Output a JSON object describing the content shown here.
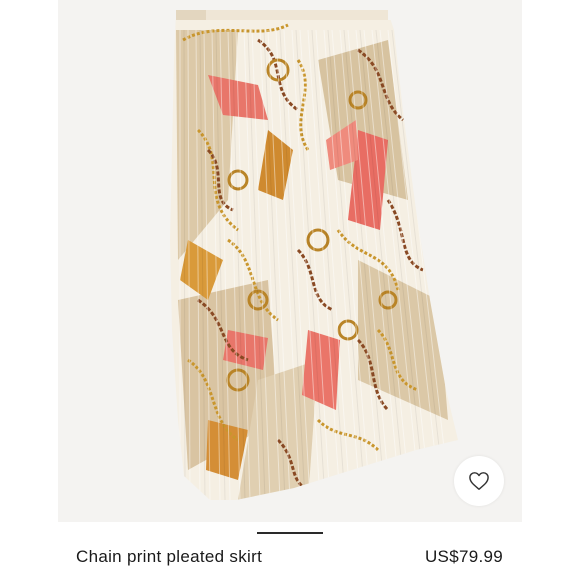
{
  "product": {
    "name": "Chain print pleated skirt",
    "price": "US$79.99",
    "image_alt": "skirt-photo"
  },
  "favorite": {
    "icon": "heart-outline-icon"
  },
  "gallery": {
    "indicator": "pager-indicator"
  }
}
